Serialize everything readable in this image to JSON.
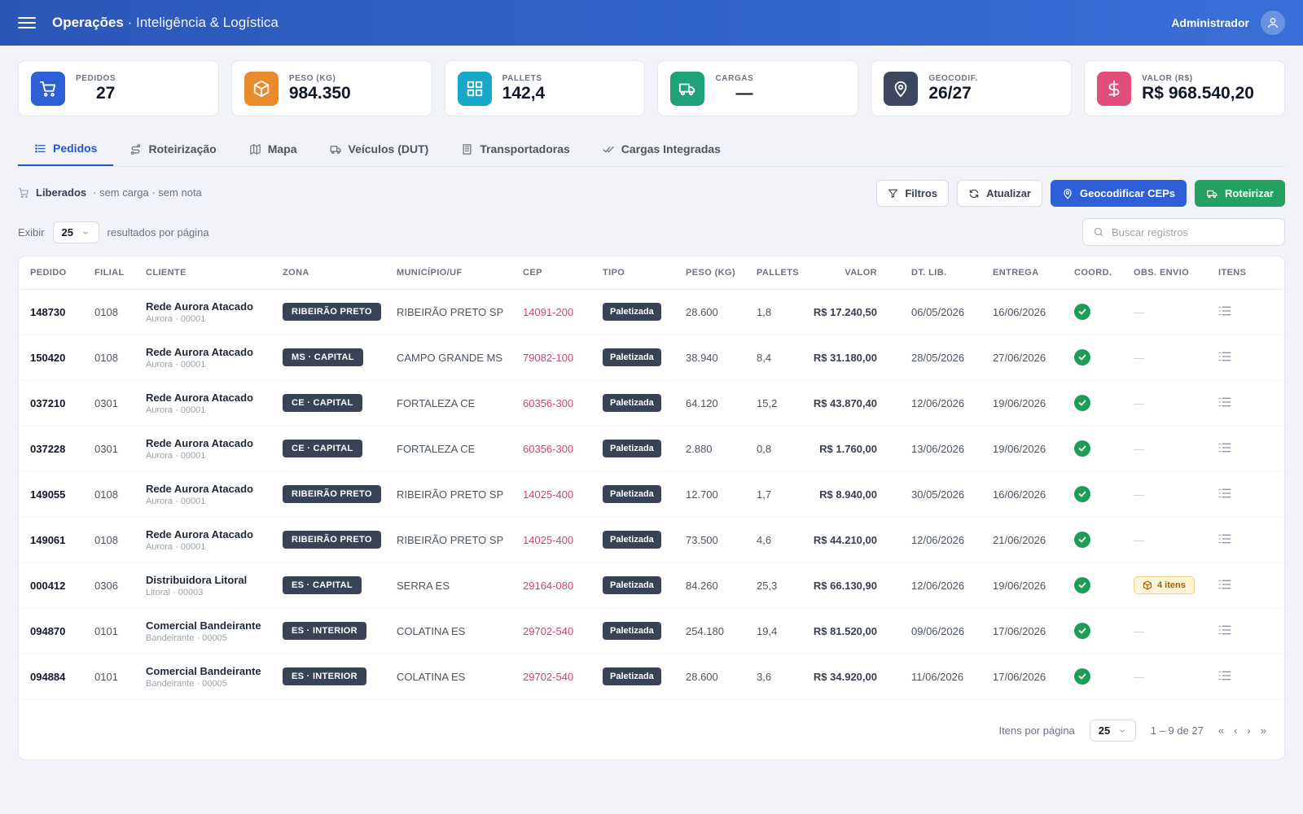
{
  "header": {
    "title": "Operações",
    "subtitle": "· Inteligência & Logística",
    "user": "Administrador"
  },
  "kpis": [
    {
      "label": "PEDIDOS",
      "value": "27",
      "color": "#2f5fd6",
      "icon": "cart-icon"
    },
    {
      "label": "PESO (KG)",
      "value": "984.350",
      "color": "#e98a2c",
      "icon": "box-icon"
    },
    {
      "label": "PALLETS",
      "value": "142,4",
      "color": "#17a7c7",
      "icon": "grid-icon"
    },
    {
      "label": "CARGAS",
      "value": "—",
      "color": "#1fa27a",
      "icon": "truck-icon"
    },
    {
      "label": "GEOCODIF.",
      "value": "26/27",
      "color": "#3d4660",
      "icon": "map-pin-icon"
    },
    {
      "label": "VALOR (R$)",
      "value": "R$ 968.540,20",
      "color": "#e34d79",
      "icon": "dollar-icon"
    }
  ],
  "tabs": [
    {
      "label": "Pedidos",
      "icon": "list-icon",
      "active": true
    },
    {
      "label": "Roteirização",
      "icon": "route-icon",
      "active": false
    },
    {
      "label": "Mapa",
      "icon": "map-icon",
      "active": false
    },
    {
      "label": "Veículos (DUT)",
      "icon": "truck-icon",
      "active": false
    },
    {
      "label": "Transportadoras",
      "icon": "building-icon",
      "active": false
    },
    {
      "label": "Cargas Integradas",
      "icon": "check-double-icon",
      "active": false
    }
  ],
  "status": {
    "title": "Liberados",
    "detail": "· sem carga · sem nota"
  },
  "actions": {
    "filters": "Filtros",
    "refresh": "Atualizar",
    "geocode": "Geocodificar CEPs",
    "route": "Roteirizar"
  },
  "page_size": {
    "show_label": "Exibir",
    "value": "25",
    "suffix": "resultados por página"
  },
  "search": {
    "placeholder": "Buscar registros"
  },
  "table": {
    "columns": [
      "PEDIDO",
      "FILIAL",
      "CLIENTE",
      "ZONA",
      "MUNICÍPIO/UF",
      "CEP",
      "TIPO",
      "PESO (KG)",
      "PALLETS",
      "VALOR",
      "DT. LIB.",
      "ENTREGA",
      "COORD.",
      "OBS. ENVIO",
      "ITENS"
    ],
    "rows": [
      {
        "pedido": "148730",
        "filial": "0108",
        "cliente": "Rede Aurora Atacado",
        "cliente_sub": "Aurora · 00001",
        "zona": "RIBEIRÃO PRETO",
        "municipio": "RIBEIRÃO PRETO SP",
        "cep": "14091-200",
        "tipo": "Paletizada",
        "peso": "28.600",
        "pallets": "1,8",
        "valor": "R$ 17.240,50",
        "dt_lib": "06/05/2026",
        "entrega": "16/06/2026",
        "obs": "—"
      },
      {
        "pedido": "150420",
        "filial": "0108",
        "cliente": "Rede Aurora Atacado",
        "cliente_sub": "Aurora · 00001",
        "zona": "MS · CAPITAL",
        "municipio": "CAMPO GRANDE MS",
        "cep": "79082-100",
        "tipo": "Paletizada",
        "peso": "38.940",
        "pallets": "8,4",
        "valor": "R$ 31.180,00",
        "dt_lib": "28/05/2026",
        "entrega": "27/06/2026",
        "obs": "—"
      },
      {
        "pedido": "037210",
        "filial": "0301",
        "cliente": "Rede Aurora Atacado",
        "cliente_sub": "Aurora · 00001",
        "zona": "CE · CAPITAL",
        "municipio": "FORTALEZA CE",
        "cep": "60356-300",
        "tipo": "Paletizada",
        "peso": "64.120",
        "pallets": "15,2",
        "valor": "R$ 43.870,40",
        "dt_lib": "12/06/2026",
        "entrega": "19/06/2026",
        "obs": "—"
      },
      {
        "pedido": "037228",
        "filial": "0301",
        "cliente": "Rede Aurora Atacado",
        "cliente_sub": "Aurora · 00001",
        "zona": "CE · CAPITAL",
        "municipio": "FORTALEZA CE",
        "cep": "60356-300",
        "tipo": "Paletizada",
        "peso": "2.880",
        "pallets": "0,8",
        "valor": "R$ 1.760,00",
        "dt_lib": "13/06/2026",
        "entrega": "19/06/2026",
        "obs": "—"
      },
      {
        "pedido": "149055",
        "filial": "0108",
        "cliente": "Rede Aurora Atacado",
        "cliente_sub": "Aurora · 00001",
        "zona": "RIBEIRÃO PRETO",
        "municipio": "RIBEIRÃO PRETO SP",
        "cep": "14025-400",
        "tipo": "Paletizada",
        "peso": "12.700",
        "pallets": "1,7",
        "valor": "R$ 8.940,00",
        "dt_lib": "30/05/2026",
        "entrega": "16/06/2026",
        "obs": "—"
      },
      {
        "pedido": "149061",
        "filial": "0108",
        "cliente": "Rede Aurora Atacado",
        "cliente_sub": "Aurora · 00001",
        "zona": "RIBEIRÃO PRETO",
        "municipio": "RIBEIRÃO PRETO SP",
        "cep": "14025-400",
        "tipo": "Paletizada",
        "peso": "73.500",
        "pallets": "4,6",
        "valor": "R$ 44.210,00",
        "dt_lib": "12/06/2026",
        "entrega": "21/06/2026",
        "obs": "—"
      },
      {
        "pedido": "000412",
        "filial": "0306",
        "cliente": "Distribuidora Litoral",
        "cliente_sub": "Litoral · 00003",
        "zona": "ES · CAPITAL",
        "municipio": "SERRA ES",
        "cep": "29164-080",
        "tipo": "Paletizada",
        "peso": "84.260",
        "pallets": "25,3",
        "valor": "R$ 66.130,90",
        "dt_lib": "12/06/2026",
        "entrega": "19/06/2026",
        "obs": "4 itens"
      },
      {
        "pedido": "094870",
        "filial": "0101",
        "cliente": "Comercial Bandeirante",
        "cliente_sub": "Bandeirante · 00005",
        "zona": "ES · INTERIOR",
        "municipio": "COLATINA ES",
        "cep": "29702-540",
        "tipo": "Paletizada",
        "peso": "254.180",
        "pallets": "19,4",
        "valor": "R$ 81.520,00",
        "dt_lib": "09/06/2026",
        "entrega": "17/06/2026",
        "obs": "—"
      },
      {
        "pedido": "094884",
        "filial": "0101",
        "cliente": "Comercial Bandeirante",
        "cliente_sub": "Bandeirante · 00005",
        "zona": "ES · INTERIOR",
        "municipio": "COLATINA ES",
        "cep": "29702-540",
        "tipo": "Paletizada",
        "peso": "28.600",
        "pallets": "3,6",
        "valor": "R$ 34.920,00",
        "dt_lib": "11/06/2026",
        "entrega": "17/06/2026",
        "obs": "—"
      }
    ]
  },
  "pagination": {
    "label": "Itens por página",
    "value": "25",
    "range": "1 – 9 de 27",
    "first": "«",
    "prev": "‹",
    "next": "›",
    "last": "»"
  }
}
